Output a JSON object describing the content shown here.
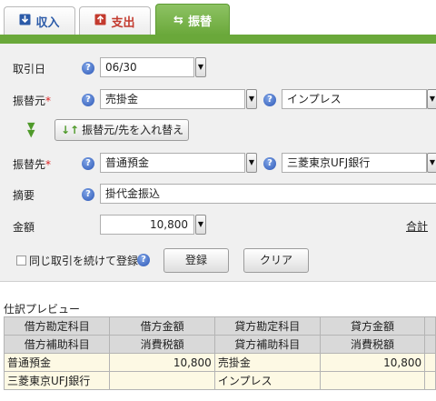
{
  "tabs": [
    {
      "label": "収入",
      "icon": "income-icon"
    },
    {
      "label": "支出",
      "icon": "expense-icon"
    },
    {
      "label": "振替",
      "icon": "transfer-icon"
    }
  ],
  "form": {
    "date_label": "取引日",
    "date_value": "06/30",
    "from_label": "振替元",
    "from_required": "*",
    "from_account": "売掛金",
    "from_sub": "インプレス",
    "swap_label": "振替元/先を入れ替え",
    "to_label": "振替先",
    "to_required": "*",
    "to_account": "普通預金",
    "to_sub": "三菱東京UFJ銀行",
    "memo_label": "摘要",
    "memo_value": "掛代金振込",
    "amount_label": "金額",
    "amount_value": "10,800",
    "total_link": "合計",
    "continue_label": "同じ取引を続けて登録",
    "register_button": "登録",
    "clear_button": "クリア"
  },
  "preview": {
    "title": "仕訳プレビュー",
    "header1": [
      "借方勘定科目",
      "借方金額",
      "貸方勘定科目",
      "貸方金額"
    ],
    "header2": [
      "借方補助科目",
      "消費税額",
      "貸方補助科目",
      "消費税額"
    ],
    "rows": [
      [
        "普通預金",
        "10,800",
        "売掛金",
        "10,800"
      ],
      [
        "三菱東京UFJ銀行",
        "",
        "インプレス",
        ""
      ]
    ]
  }
}
